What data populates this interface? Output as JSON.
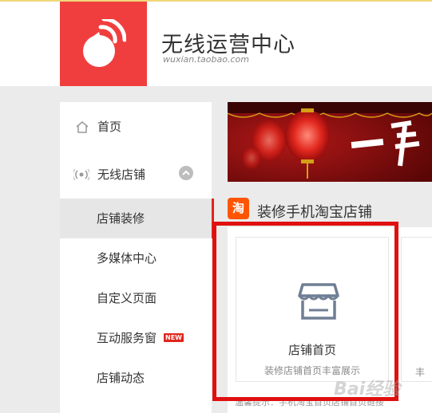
{
  "header": {
    "title": "无线运营中心",
    "subtitle": "wuxian.taobao.com"
  },
  "sidebar": {
    "items": [
      {
        "label": "首页",
        "icon": "home-icon"
      },
      {
        "label": "无线店铺",
        "icon": "signal-icon"
      },
      {
        "label": "店铺装修",
        "active": true
      },
      {
        "label": "多媒体中心"
      },
      {
        "label": "自定义页面"
      },
      {
        "label": "互动服务窗",
        "badge": "NEW"
      },
      {
        "label": "店铺动态"
      }
    ]
  },
  "section": {
    "icon_text": "淘",
    "title": "装修手机淘宝店铺"
  },
  "cards": [
    {
      "title": "店铺首页",
      "desc": "装修店铺首页丰富展示",
      "icon": "store-icon"
    },
    {
      "desc": "丰"
    }
  ],
  "tip": "温馨提示：手机淘宝首页店铺首页链接",
  "watermark": "Bai经验",
  "colors": {
    "accent": "#e1251b",
    "logo": "#f03e3e",
    "highlight": "#e01010"
  }
}
